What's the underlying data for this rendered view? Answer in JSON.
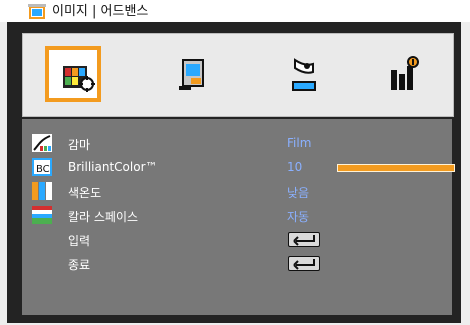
{
  "window": {
    "title": "이미지 | 어드밴스"
  },
  "tabs": [
    {
      "icon": "picture-settings-icon",
      "active": true
    },
    {
      "icon": "display-settings-icon",
      "active": false
    },
    {
      "icon": "setup-icon",
      "active": false
    },
    {
      "icon": "options-icon",
      "active": false
    }
  ],
  "menu": {
    "items": [
      {
        "label": "감마",
        "value": "Film",
        "icon": "gamma-curve-icon"
      },
      {
        "label": "BrilliantColor™",
        "value": "10",
        "icon": "brilliantcolor-icon",
        "slider_level": 1.0
      },
      {
        "label": "색온도",
        "value": "낮음",
        "icon": "color-temperature-icon"
      },
      {
        "label": "칼라 스페이스",
        "value": "자동",
        "icon": "color-space-icon"
      },
      {
        "label": "입력",
        "value": "",
        "icon": "enter-icon"
      },
      {
        "label": "종료",
        "value": "",
        "icon": "enter-icon"
      }
    ]
  },
  "colors": {
    "accent": "#f39b1f",
    "value_text": "#8ab0ff",
    "panel_bg": "#787878"
  }
}
